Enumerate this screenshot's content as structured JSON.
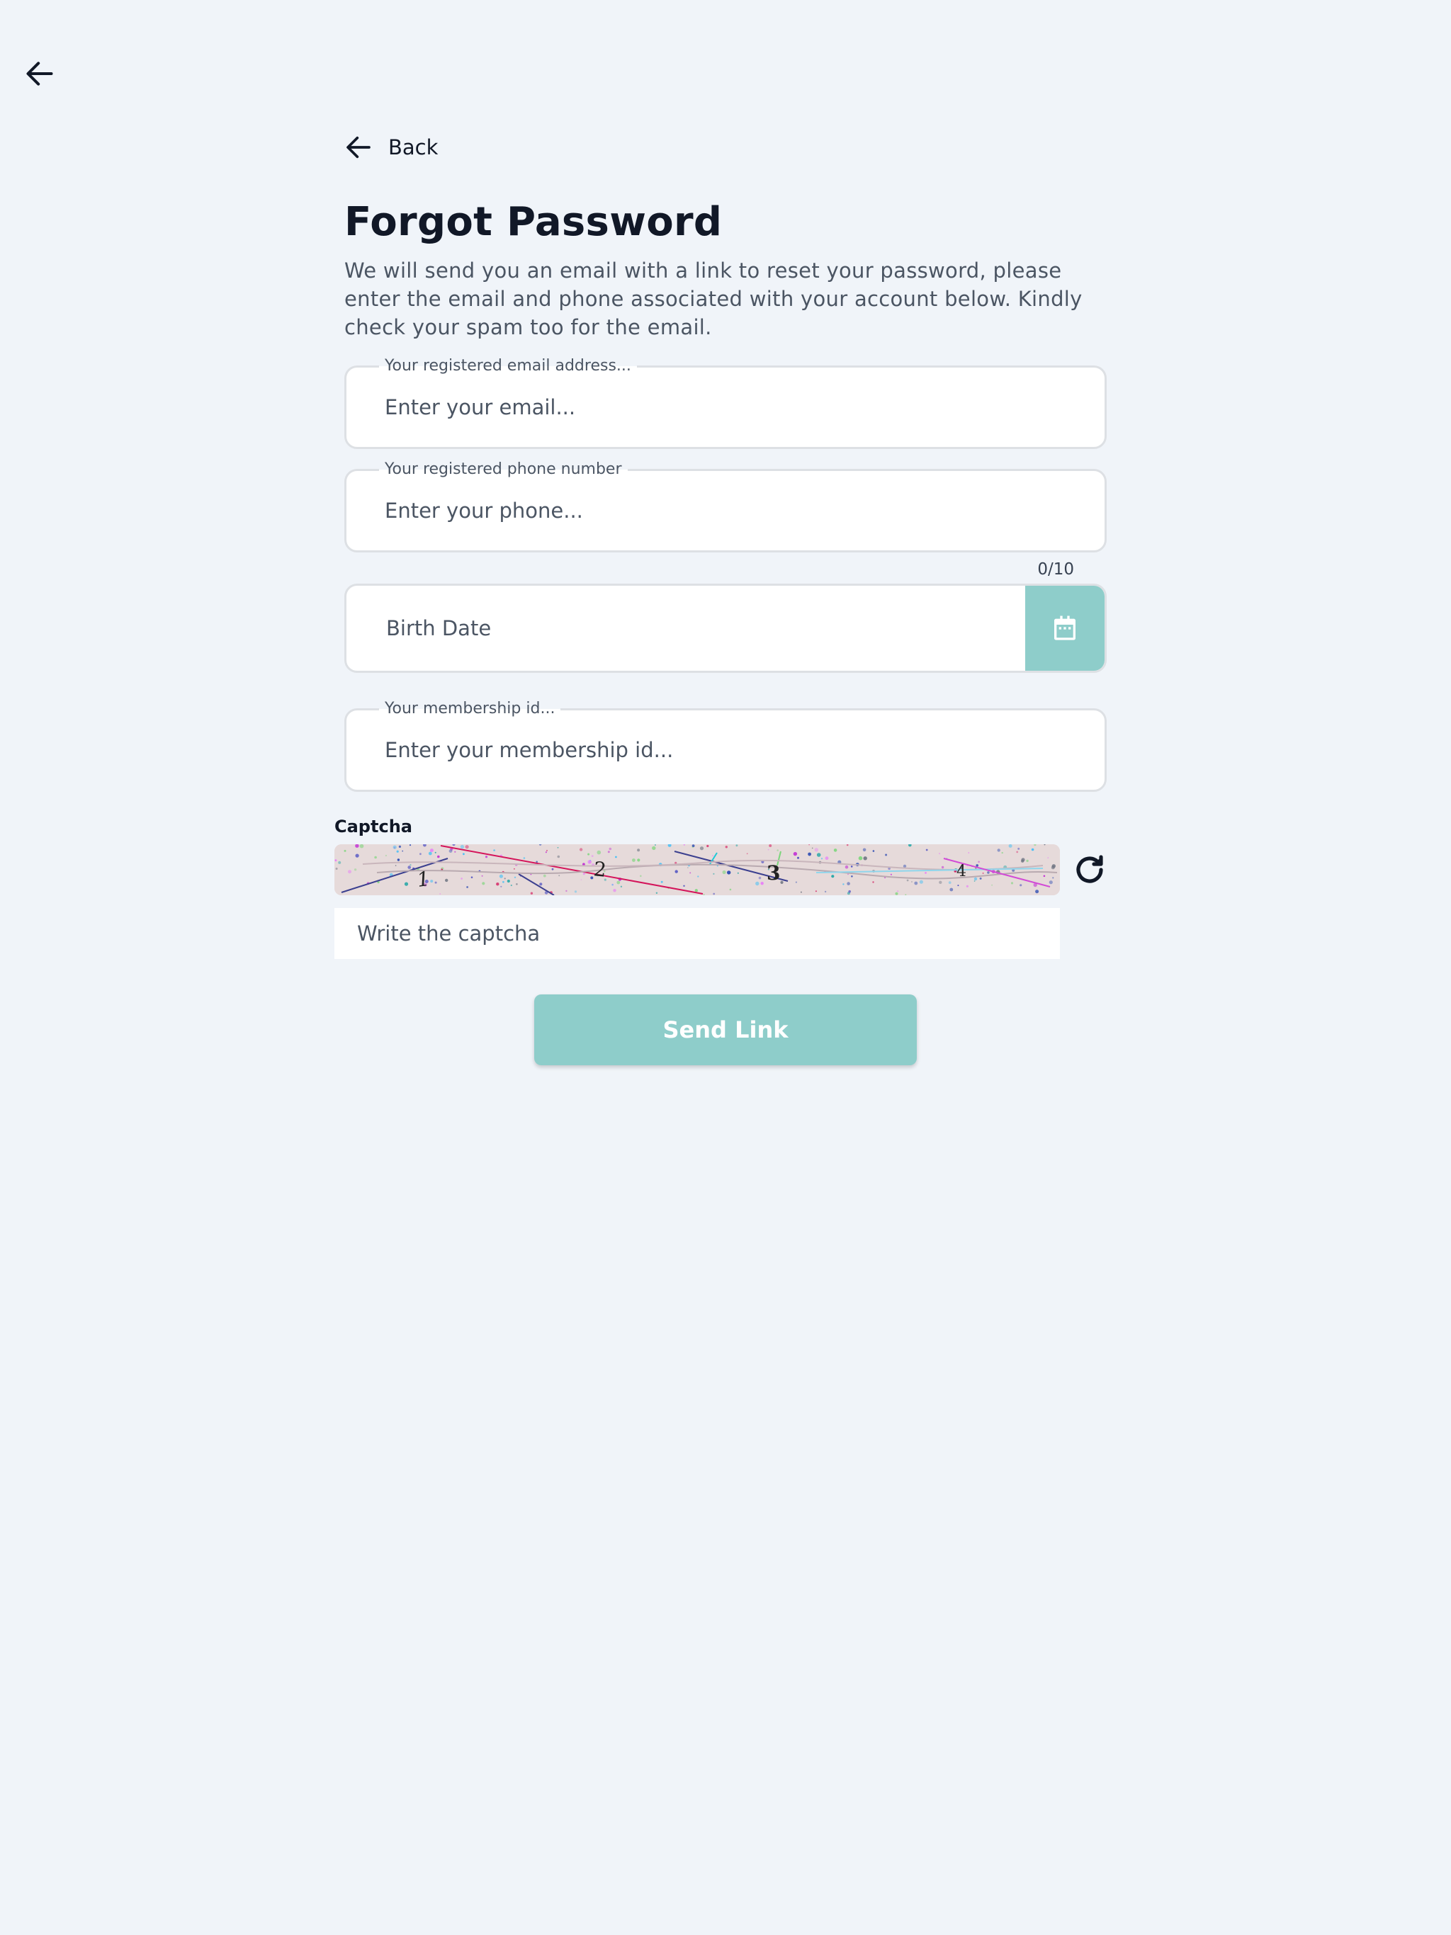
{
  "header": {
    "back_icon": "arrow-left-icon"
  },
  "form": {
    "back_label": "Back",
    "title": "Forgot Password",
    "description": "We will send you an email with a link to reset your password, please enter the email and phone associated with your account below. Kindly check your spam too for the email.",
    "email": {
      "label": "Your registered email address...",
      "placeholder": "Enter your email...",
      "value": ""
    },
    "phone": {
      "label": "Your registered phone number",
      "placeholder": "Enter your phone...",
      "value": "",
      "counter": "0/10"
    },
    "birth_date": {
      "placeholder": "Birth Date",
      "icon": "calendar-icon"
    },
    "membership": {
      "label": "Your membership id...",
      "placeholder": "Enter your membership id...",
      "value": ""
    },
    "captcha": {
      "label": "Captcha",
      "characters": [
        "1",
        "2",
        "3",
        "4"
      ],
      "input_placeholder": "Write the captcha",
      "refresh_icon": "refresh-icon"
    },
    "submit_label": "Send Link"
  },
  "colors": {
    "background": "#f0f4f9",
    "accent": "#8ecdca",
    "field_border": "#dde0e4",
    "captcha_bg": "#e6dada"
  }
}
